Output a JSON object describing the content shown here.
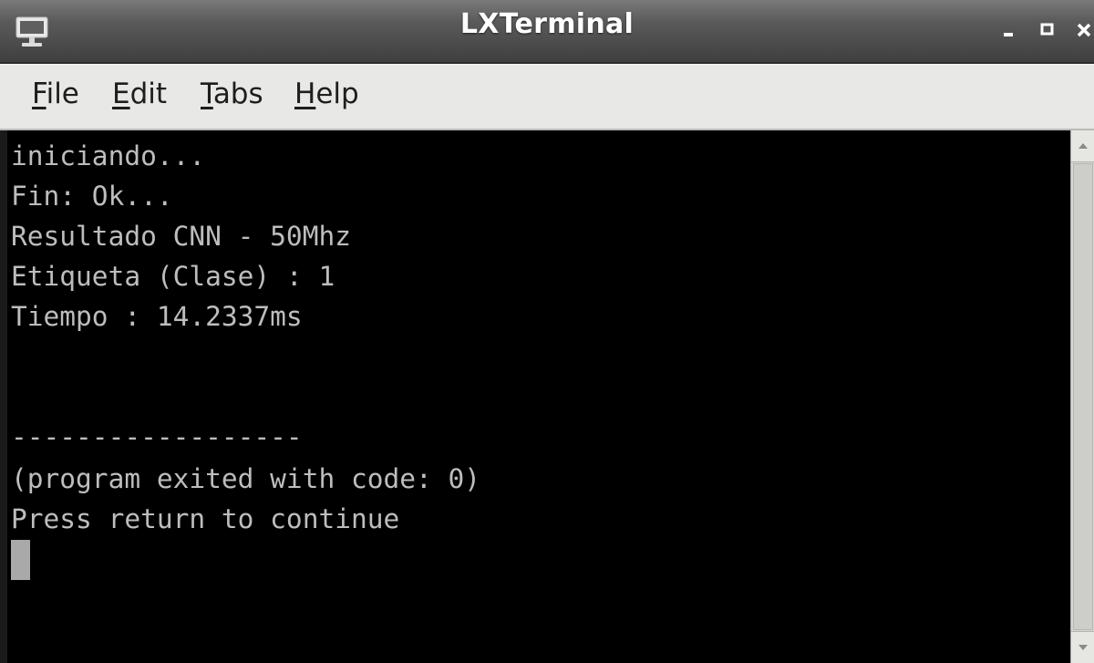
{
  "window": {
    "title": "LXTerminal",
    "app_icon": "terminal-monitor-icon",
    "controls": [
      "minimize-icon",
      "maximize-icon",
      "close-icon"
    ]
  },
  "menu": {
    "items": [
      {
        "accel": "F",
        "rest": "ile"
      },
      {
        "accel": "E",
        "rest": "dit"
      },
      {
        "accel": "T",
        "rest": "abs"
      },
      {
        "accel": "H",
        "rest": "elp"
      }
    ]
  },
  "terminal": {
    "lines": [
      "iniciando...",
      "Fin: Ok...",
      "Resultado CNN - 50Mhz",
      "Etiqueta (Clase) : 1",
      "Tiempo : 14.2337ms",
      "",
      "",
      "------------------",
      "(program exited with code: 0)",
      "Press return to continue"
    ]
  },
  "colors": {
    "terminal_bg": "#000000",
    "terminal_fg": "#bdbdbd",
    "titlebar": "#4f4f4f",
    "menubar": "#e8e8e6"
  }
}
